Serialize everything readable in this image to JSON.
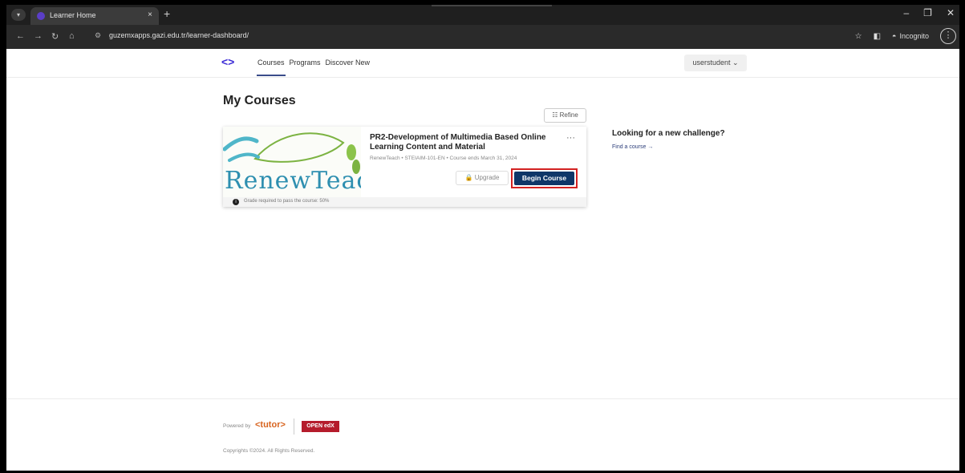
{
  "browser": {
    "tab_title": "Learner Home",
    "tab_close": "×",
    "new_tab": "+",
    "url": "guzemxapps.gazi.edu.tr/learner-dashboard/",
    "incognito_label": "Incognito",
    "min_icon": "–",
    "restore_icon": "❐",
    "close_icon": "✕"
  },
  "header": {
    "logo": "<>",
    "nav": [
      "Courses",
      "Programs",
      "Discover New"
    ],
    "user": "userstudent"
  },
  "main": {
    "title": "My Courses",
    "refine_label": "Refine",
    "course": {
      "image_text": "RenewTeach",
      "title": "PR2-Development of Multimedia Based Online Learning Content and Material",
      "meta": "RenewTeach • STEIAIM-101-EN • Course ends March 31, 2024",
      "upgrade_label": "Upgrade",
      "begin_label": "Begin Course",
      "grade_note": "Grade required to pass the course: 50%"
    },
    "sidebar": {
      "title": "Looking for a new challenge?",
      "link": "Find a course →"
    }
  },
  "footer": {
    "powered_by": "Powered by",
    "tutor": "<tutor>",
    "openedx": "OPEN edX",
    "copyright": "Copyrights ©2024. All Rights Reserved."
  },
  "colors": {
    "primary": "#0f3668",
    "highlight": "#d32222",
    "brand": "#3b2bd6"
  }
}
